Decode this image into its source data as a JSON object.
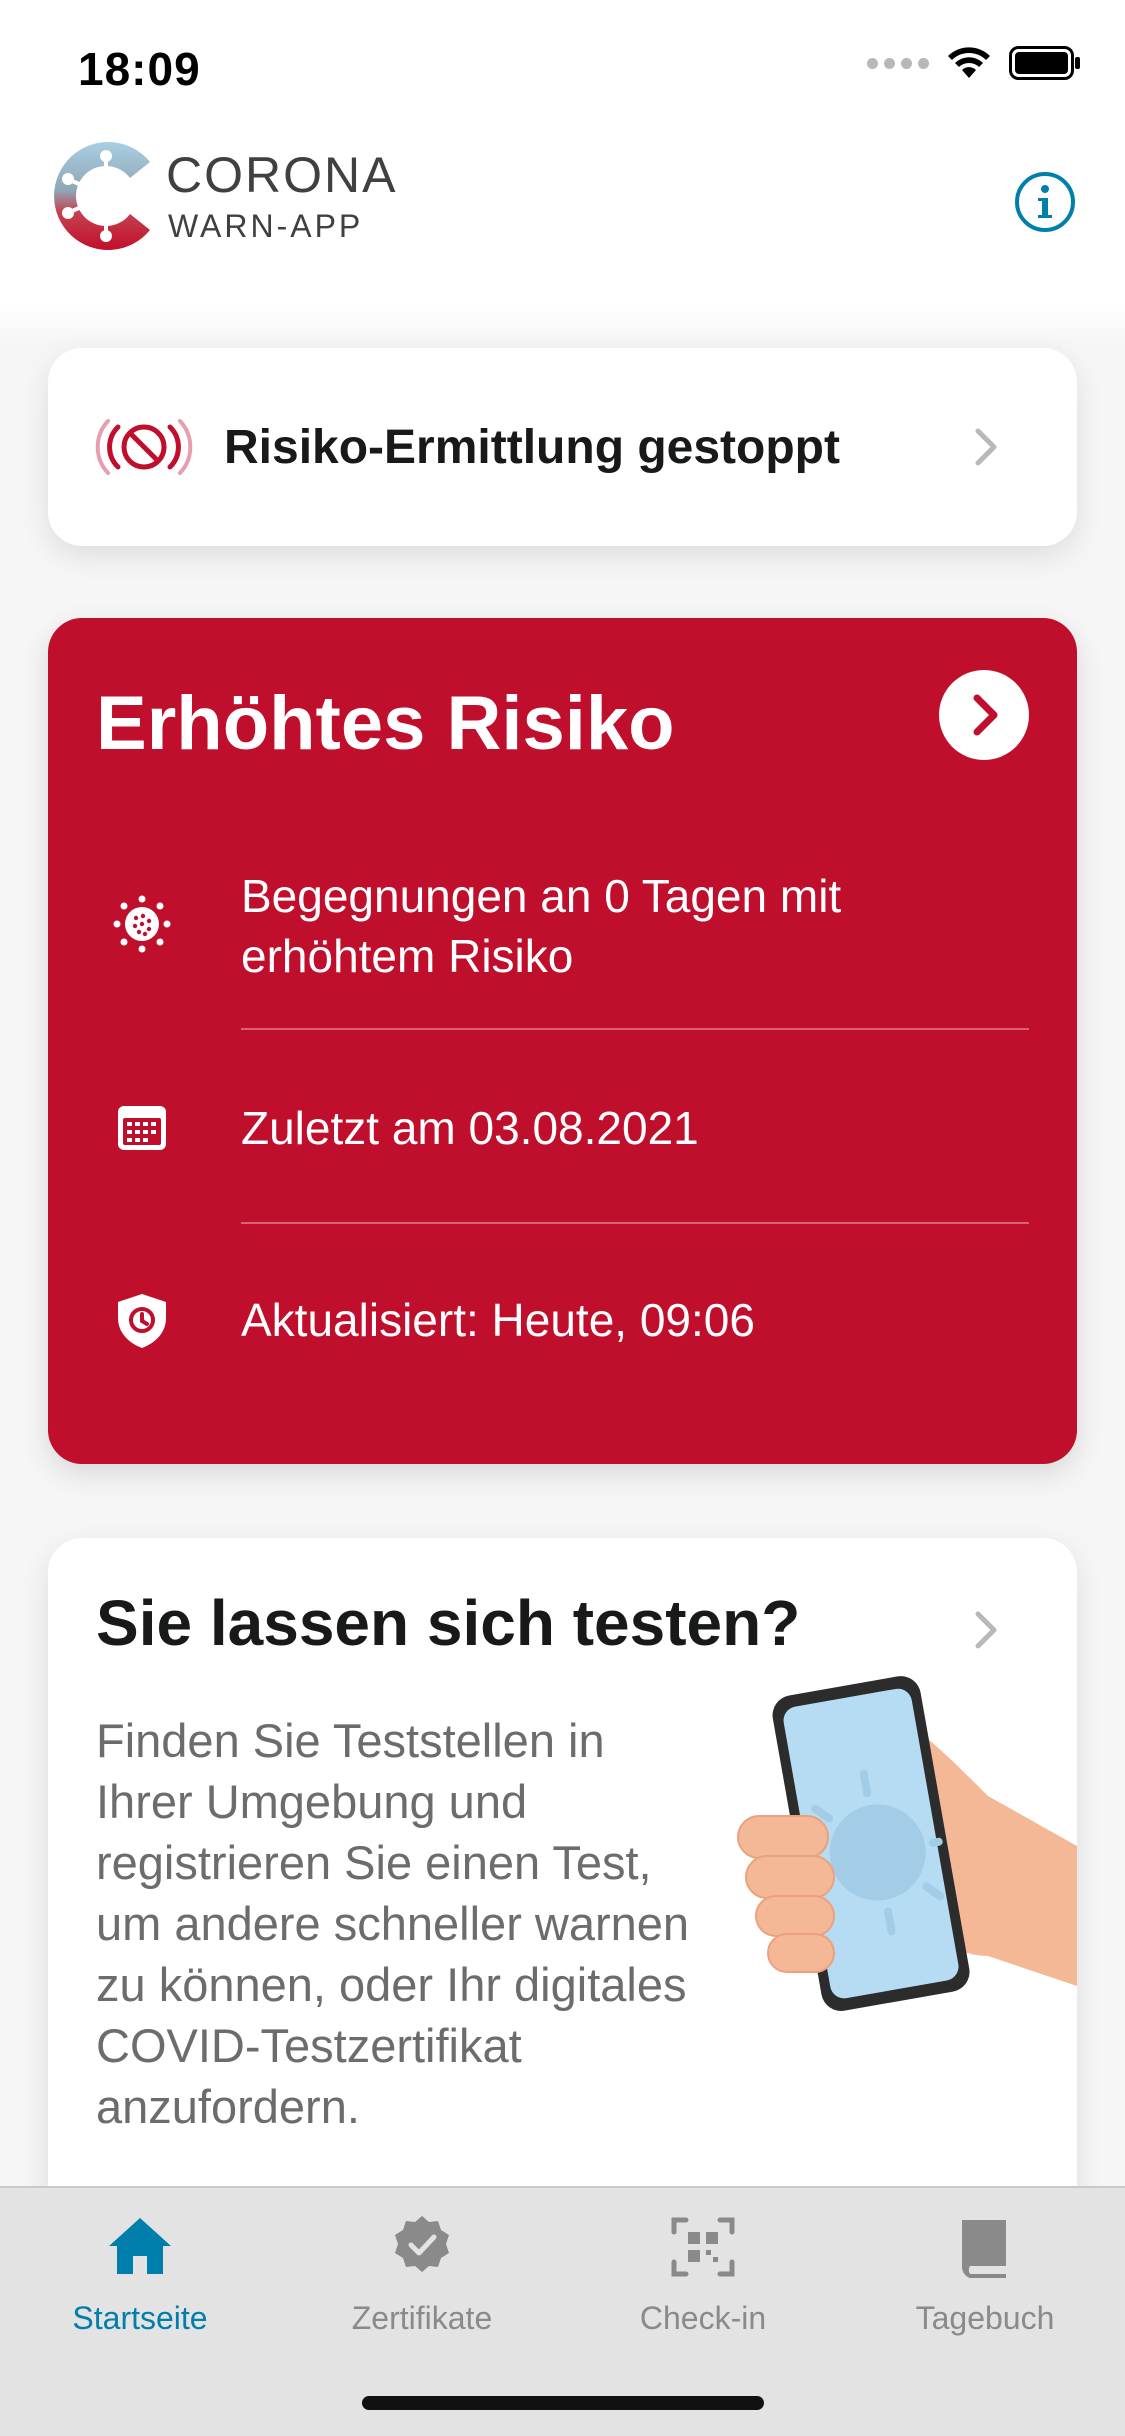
{
  "status_bar": {
    "time": "18:09"
  },
  "header": {
    "brand_title": "CORONA",
    "brand_subtitle": "WARN-APP",
    "info_icon": "info-icon"
  },
  "risk_stopped": {
    "label": "Risiko-Ermittlung gestoppt",
    "icon": "stopped-exposure-icon"
  },
  "risk_card": {
    "title": "Erhöhtes Risiko",
    "color": "#c00f2d",
    "rows": [
      {
        "icon": "virus-icon",
        "text": "Begegnungen an 0 Tagen mit erhöhtem Risiko"
      },
      {
        "icon": "calendar-icon",
        "text": "Zuletzt am 03.08.2021"
      },
      {
        "icon": "shield-clock-icon",
        "text": "Aktualisiert: Heute, 09:06"
      }
    ]
  },
  "test_card": {
    "title": "Sie lassen sich testen?",
    "body": "Finden Sie Teststellen in Ihrer Umgebung und registrieren Sie einen Test, um andere schneller warnen zu können, oder Ihr digitales COVID-Testzertifikat anzufordern.",
    "illustration": "hand-holding-phone"
  },
  "tabs": [
    {
      "label": "Startseite",
      "icon": "home-icon",
      "active": true
    },
    {
      "label": "Zertifikate",
      "icon": "certificate-icon",
      "active": false
    },
    {
      "label": "Check-in",
      "icon": "qr-scan-icon",
      "active": false
    },
    {
      "label": "Tagebuch",
      "icon": "diary-book-icon",
      "active": false
    }
  ],
  "colors": {
    "accent": "#007fad",
    "risk_red": "#c00f2d",
    "inactive_tab": "#8a8a8a"
  }
}
